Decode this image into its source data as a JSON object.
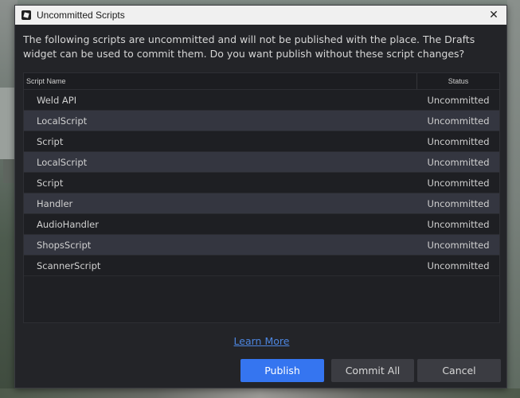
{
  "window": {
    "title": "Uncommitted Scripts",
    "close_symbol": "✕"
  },
  "message": "The following scripts are uncommitted and will not be published with the place. The Drafts widget can be used to commit them. Do you want publish without these script changes?",
  "table": {
    "columns": [
      "Script Name",
      "Status"
    ],
    "rows": [
      {
        "name": "Weld API",
        "status": "Uncommitted"
      },
      {
        "name": "LocalScript",
        "status": "Uncommitted"
      },
      {
        "name": "Script",
        "status": "Uncommitted"
      },
      {
        "name": "LocalScript",
        "status": "Uncommitted"
      },
      {
        "name": "Script",
        "status": "Uncommitted"
      },
      {
        "name": "Handler",
        "status": "Uncommitted"
      },
      {
        "name": "AudioHandler",
        "status": "Uncommitted"
      },
      {
        "name": "ShopsScript",
        "status": "Uncommitted"
      },
      {
        "name": "ScannerScript",
        "status": "Uncommitted"
      }
    ]
  },
  "links": {
    "learn_more": "Learn More"
  },
  "buttons": {
    "publish": "Publish",
    "commit_all": "Commit All",
    "cancel": "Cancel"
  },
  "colors": {
    "dialog_bg": "#232428",
    "accent": "#3575f0",
    "link": "#4d86e0",
    "row_alt": "#343640"
  },
  "icons": {
    "app": "studio-logo-icon",
    "close": "close-icon"
  }
}
